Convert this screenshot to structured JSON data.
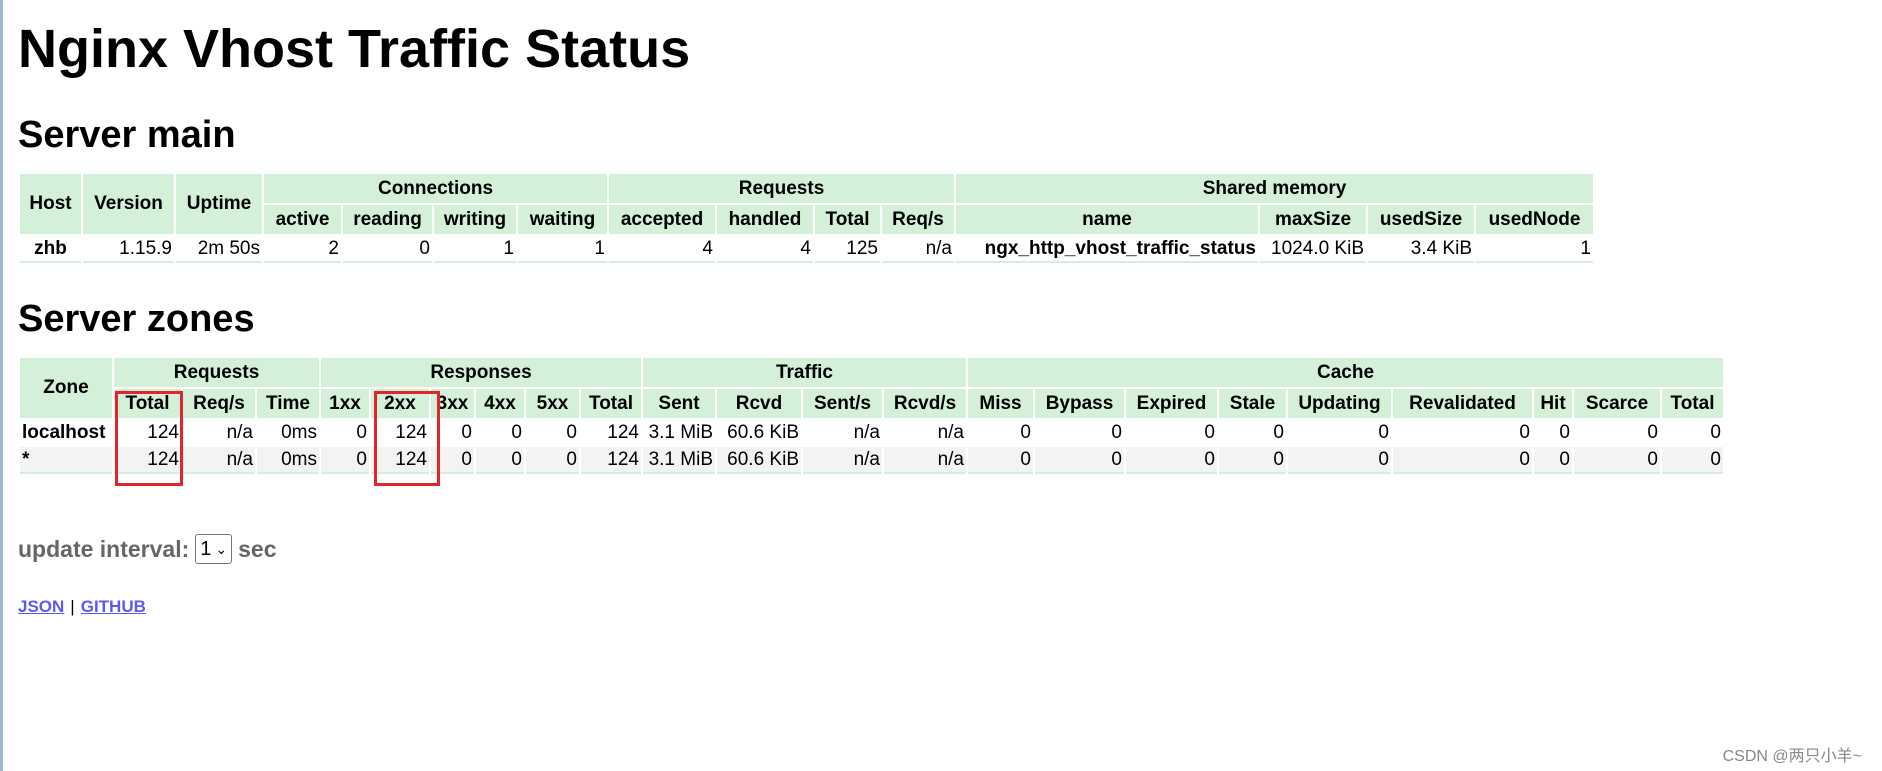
{
  "title": "Nginx Vhost Traffic Status",
  "server_main": {
    "heading": "Server main",
    "headers": {
      "host": "Host",
      "version": "Version",
      "uptime": "Uptime",
      "connections": "Connections",
      "requests": "Requests",
      "shared_memory": "Shared memory"
    },
    "sub": [
      "active",
      "reading",
      "writing",
      "waiting",
      "accepted",
      "handled",
      "Total",
      "Req/s",
      "name",
      "maxSize",
      "usedSize",
      "usedNode"
    ],
    "row": [
      "zhb",
      "1.15.9",
      "2m 50s",
      "2",
      "0",
      "1",
      "1",
      "4",
      "4",
      "125",
      "n/a",
      "ngx_http_vhost_traffic_status",
      "1024.0 KiB",
      "3.4 KiB",
      "1"
    ]
  },
  "server_zones": {
    "heading": "Server zones",
    "headers": {
      "zone": "Zone",
      "requests": "Requests",
      "responses": "Responses",
      "traffic": "Traffic",
      "cache": "Cache"
    },
    "sub": [
      "Total",
      "Req/s",
      "Time",
      "1xx",
      "2xx",
      "3xx",
      "4xx",
      "5xx",
      "Total",
      "Sent",
      "Rcvd",
      "Sent/s",
      "Rcvd/s",
      "Miss",
      "Bypass",
      "Expired",
      "Stale",
      "Updating",
      "Revalidated",
      "Hit",
      "Scarce",
      "Total"
    ],
    "rows": [
      [
        "localhost",
        "124",
        "n/a",
        "0ms",
        "0",
        "124",
        "0",
        "0",
        "0",
        "124",
        "3.1 MiB",
        "60.6 KiB",
        "n/a",
        "n/a",
        "0",
        "0",
        "0",
        "0",
        "0",
        "0",
        "0",
        "0",
        "0"
      ],
      [
        "*",
        "124",
        "n/a",
        "0ms",
        "0",
        "124",
        "0",
        "0",
        "0",
        "124",
        "3.1 MiB",
        "60.6 KiB",
        "n/a",
        "n/a",
        "0",
        "0",
        "0",
        "0",
        "0",
        "0",
        "0",
        "0",
        "0"
      ]
    ]
  },
  "update": {
    "label": "update interval:",
    "value": "1",
    "unit": "sec"
  },
  "links": {
    "json": "JSON",
    "sep": "|",
    "github": "GITHUB"
  },
  "watermark": "CSDN @两只小羊~",
  "colors": {
    "header_bg": "#d4f0d9",
    "highlight": "#e0262b",
    "link": "#5a5af0"
  }
}
